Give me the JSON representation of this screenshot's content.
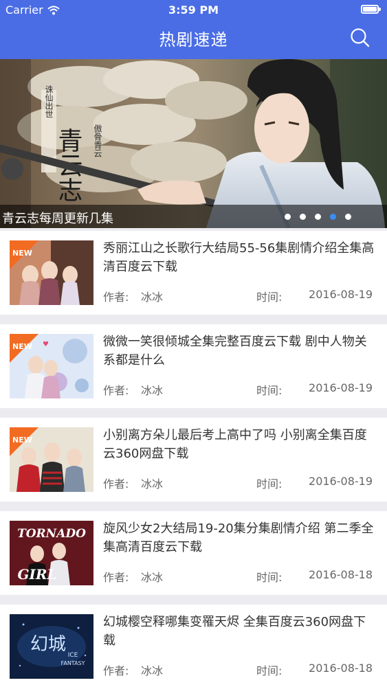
{
  "status_bar": {
    "carrier": "Carrier",
    "time": "3:59 PM"
  },
  "header": {
    "title": "热剧速递"
  },
  "banner": {
    "caption": "青云志每周更新几集",
    "poster_text": [
      "诛仙出世",
      "青云志",
      "傲骨青云"
    ],
    "dot_count": 5,
    "active_dot": 4
  },
  "labels": {
    "author": "作者:",
    "time": "时间:"
  },
  "items": [
    {
      "title": "秀丽江山之长歌行大结局55-56集剧情介绍全集高清百度云下载",
      "author": "冰冰",
      "date": "2016-08-19",
      "badge": "NEW"
    },
    {
      "title": "微微一笑很倾城全集完整百度云下载 剧中人物关系都是什么",
      "author": "冰冰",
      "date": "2016-08-19",
      "badge": "NEW"
    },
    {
      "title": "小别离方朵儿最后考上高中了吗 小别离全集百度云360网盘下载",
      "author": "冰冰",
      "date": "2016-08-19",
      "badge": "NEW"
    },
    {
      "title": "旋风少女2大结局19-20集分集剧情介绍 第二季全集高清百度云下载",
      "author": "冰冰",
      "date": "2016-08-18",
      "poster_text": [
        "TORNADO",
        "GIRL"
      ]
    },
    {
      "title": "幻城樱空释哪集变罹天烬 全集百度云360网盘下载",
      "author": "冰冰",
      "date": "2016-08-18",
      "poster_text": [
        "幻城",
        "ICE",
        "FANTASY"
      ]
    }
  ],
  "colors": {
    "header_bg": "#4a6de5",
    "active_dot": "#3b8ef0",
    "badge": "#f26b22"
  }
}
